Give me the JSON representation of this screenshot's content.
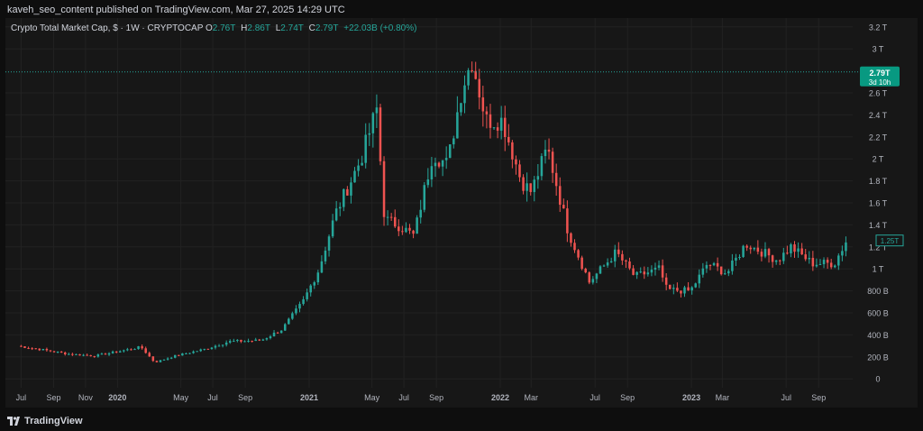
{
  "header": {
    "published": "kaveh_seo_content published on TradingView.com, Mar 27, 2025 14:29 UTC"
  },
  "legend": {
    "symbol": "Crypto Total Market Cap, $ · 1W · CRYPTOCAP",
    "o_label": "O",
    "o_value": "2.76T",
    "h_label": "H",
    "h_value": "2.86T",
    "l_label": "L",
    "l_value": "2.74T",
    "c_label": "C",
    "c_value": "2.79T",
    "change": "+22.03B (+0.80%)"
  },
  "price_tag": {
    "value": "2.79T",
    "countdown": "3d 10h"
  },
  "secondary_tag": {
    "value": "1.25T"
  },
  "footer": {
    "brand": "TradingView"
  },
  "colors": {
    "up": "#26a69a",
    "down": "#ef5350",
    "background": "#171717",
    "grid": "#222222",
    "text": "#d1d4dc",
    "price_line": "#26a69a"
  },
  "chart_data": {
    "type": "candlestick",
    "title": "Crypto Total Market Cap, $ · 1W · CRYPTOCAP",
    "y_unit": "USD (B)",
    "ylim": [
      -80,
      3280
    ],
    "y_ticks": [
      {
        "v": 0,
        "label": "0"
      },
      {
        "v": 200,
        "label": "200 B"
      },
      {
        "v": 400,
        "label": "400 B"
      },
      {
        "v": 600,
        "label": "600 B"
      },
      {
        "v": 800,
        "label": "800 B"
      },
      {
        "v": 1000,
        "label": "1 T"
      },
      {
        "v": 1200,
        "label": "1.2 T"
      },
      {
        "v": 1400,
        "label": "1.4 T"
      },
      {
        "v": 1600,
        "label": "1.6 T"
      },
      {
        "v": 1800,
        "label": "1.8 T"
      },
      {
        "v": 2000,
        "label": "2 T"
      },
      {
        "v": 2200,
        "label": "2.2 T"
      },
      {
        "v": 2400,
        "label": "2.4 T"
      },
      {
        "v": 2600,
        "label": "2.6 T"
      },
      {
        "v": 3000,
        "label": "3 T"
      },
      {
        "v": 3200,
        "label": "3.2 T"
      }
    ],
    "last_price": 2790,
    "x_ticks": [
      {
        "date": "2019-07-01",
        "label": "Jul",
        "bold": false
      },
      {
        "date": "2019-09-01",
        "label": "Sep",
        "bold": false
      },
      {
        "date": "2019-11-01",
        "label": "Nov",
        "bold": false
      },
      {
        "date": "2020-01-01",
        "label": "2020",
        "bold": true
      },
      {
        "date": "2020-05-01",
        "label": "May",
        "bold": false
      },
      {
        "date": "2020-07-01",
        "label": "Jul",
        "bold": false
      },
      {
        "date": "2020-09-01",
        "label": "Sep",
        "bold": false
      },
      {
        "date": "2021-01-01",
        "label": "2021",
        "bold": true
      },
      {
        "date": "2021-05-01",
        "label": "May",
        "bold": false
      },
      {
        "date": "2021-07-01",
        "label": "Jul",
        "bold": false
      },
      {
        "date": "2021-09-01",
        "label": "Sep",
        "bold": false
      },
      {
        "date": "2022-01-01",
        "label": "2022",
        "bold": true
      },
      {
        "date": "2022-03-01",
        "label": "Mar",
        "bold": false
      },
      {
        "date": "2022-07-01",
        "label": "Jul",
        "bold": false
      },
      {
        "date": "2022-09-01",
        "label": "Sep",
        "bold": false
      },
      {
        "date": "2023-01-01",
        "label": "2023",
        "bold": true
      },
      {
        "date": "2023-03-01",
        "label": "Mar",
        "bold": false
      },
      {
        "date": "2023-07-01",
        "label": "Jul",
        "bold": false
      },
      {
        "date": "2023-09-01",
        "label": "Sep",
        "bold": false
      }
    ],
    "anchors": [
      [
        "2019-06-24",
        300,
        340,
        260
      ],
      [
        "2019-08-05",
        270,
        300,
        235
      ],
      [
        "2019-10-01",
        225,
        255,
        200
      ],
      [
        "2019-11-20",
        210,
        240,
        190
      ],
      [
        "2020-02-15",
        290,
        310,
        260
      ],
      [
        "2020-03-12",
        150,
        240,
        130
      ],
      [
        "2020-04-20",
        210,
        240,
        190
      ],
      [
        "2020-06-15",
        270,
        290,
        250
      ],
      [
        "2020-08-01",
        340,
        380,
        320
      ],
      [
        "2020-10-01",
        350,
        380,
        320
      ],
      [
        "2020-11-10",
        450,
        500,
        420
      ],
      [
        "2020-12-20",
        700,
        760,
        640
      ],
      [
        "2021-01-20",
        1000,
        1100,
        900
      ],
      [
        "2021-02-20",
        1500,
        1600,
        1350
      ],
      [
        "2021-04-10",
        2000,
        2150,
        1850
      ],
      [
        "2021-05-10",
        2450,
        2620,
        2300
      ],
      [
        "2021-05-25",
        1450,
        1800,
        1200
      ],
      [
        "2021-06-20",
        1400,
        1550,
        1250
      ],
      [
        "2021-07-20",
        1300,
        1400,
        1180
      ],
      [
        "2021-08-25",
        2050,
        2200,
        1950
      ],
      [
        "2021-09-22",
        1950,
        2100,
        1850
      ],
      [
        "2021-10-20",
        2650,
        2800,
        2500
      ],
      [
        "2021-11-08",
        2900,
        3020,
        2750
      ],
      [
        "2021-12-05",
        2350,
        2500,
        2150
      ],
      [
        "2022-01-05",
        2350,
        2500,
        2250
      ],
      [
        "2022-02-10",
        1800,
        1950,
        1620
      ],
      [
        "2022-03-01",
        1700,
        1850,
        1580
      ],
      [
        "2022-04-01",
        2100,
        2200,
        1950
      ],
      [
        "2022-05-10",
        1350,
        1500,
        1200
      ],
      [
        "2022-06-20",
        880,
        1000,
        820
      ],
      [
        "2022-08-10",
        1150,
        1200,
        1050
      ],
      [
        "2022-09-15",
        930,
        1000,
        880
      ],
      [
        "2022-11-01",
        1000,
        1080,
        940
      ],
      [
        "2022-11-15",
        810,
        900,
        760
      ],
      [
        "2022-12-30",
        800,
        860,
        760
      ],
      [
        "2023-02-01",
        1050,
        1100,
        990
      ],
      [
        "2023-03-10",
        960,
        1030,
        920
      ],
      [
        "2023-04-15",
        1230,
        1270,
        1150
      ],
      [
        "2023-06-15",
        1080,
        1150,
        1000
      ],
      [
        "2023-07-10",
        1200,
        1250,
        1150
      ],
      [
        "2023-08-20",
        1050,
        1100,
        1020
      ],
      [
        "2023-10-01",
        1050,
        1080,
        1020
      ],
      [
        "2023-10-23",
        1250,
        1280,
        1150
      ]
    ]
  }
}
